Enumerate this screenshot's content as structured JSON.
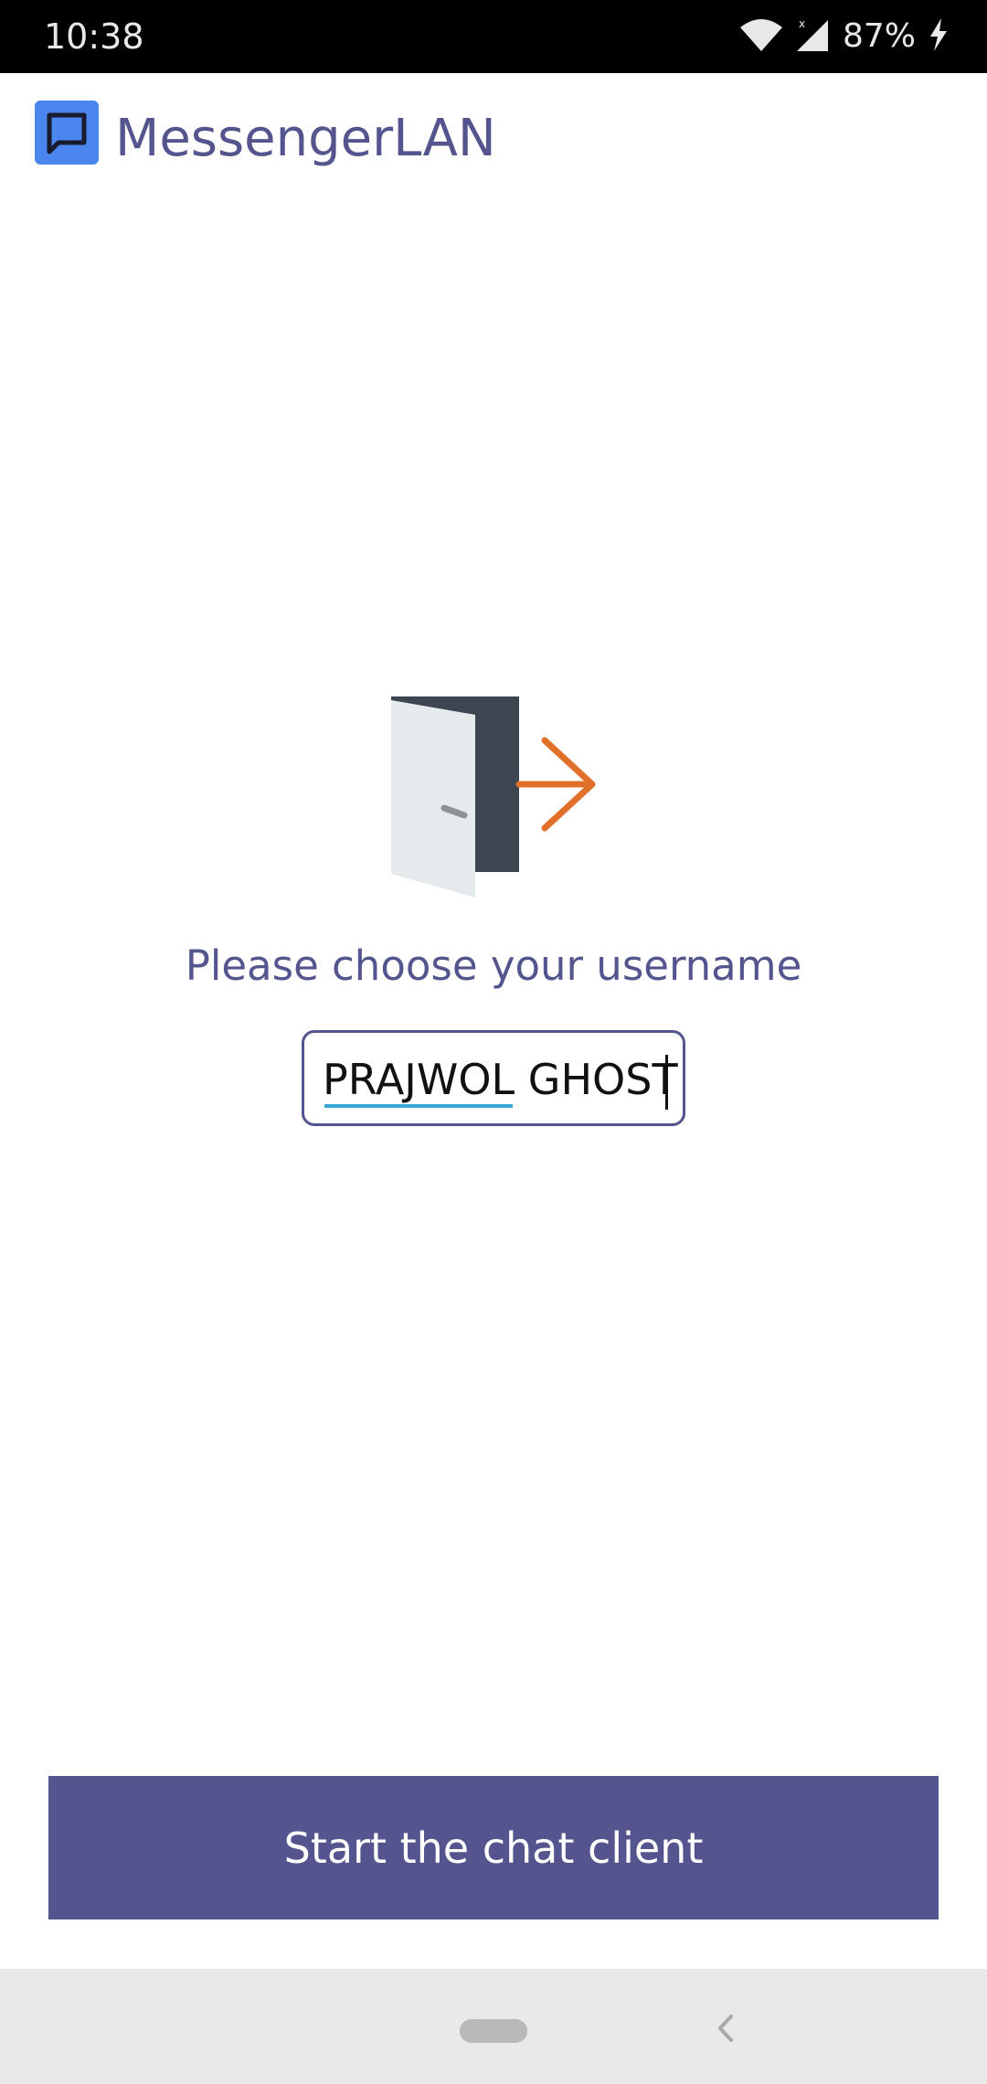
{
  "status_bar": {
    "time": "10:38",
    "battery": "87%",
    "icons": [
      "wifi-icon",
      "signal-icon",
      "battery-charging-icon"
    ]
  },
  "app_bar": {
    "title": "MessengerLAN",
    "logo_icon": "chat-bubble-icon",
    "logo_color": "#4a86ee",
    "title_color": "#54558e"
  },
  "main": {
    "illustration_icon": "door-exit-icon",
    "prompt": "Please choose your username",
    "username_value": "PRAJWOL GHOST",
    "accent_color": "#54558e",
    "arrow_color": "#e0702a"
  },
  "actions": {
    "start_label": "Start the chat client",
    "button_color": "#54548e"
  },
  "nav_bar": {
    "icons": [
      "home-pill-icon",
      "back-chevron-icon"
    ]
  }
}
